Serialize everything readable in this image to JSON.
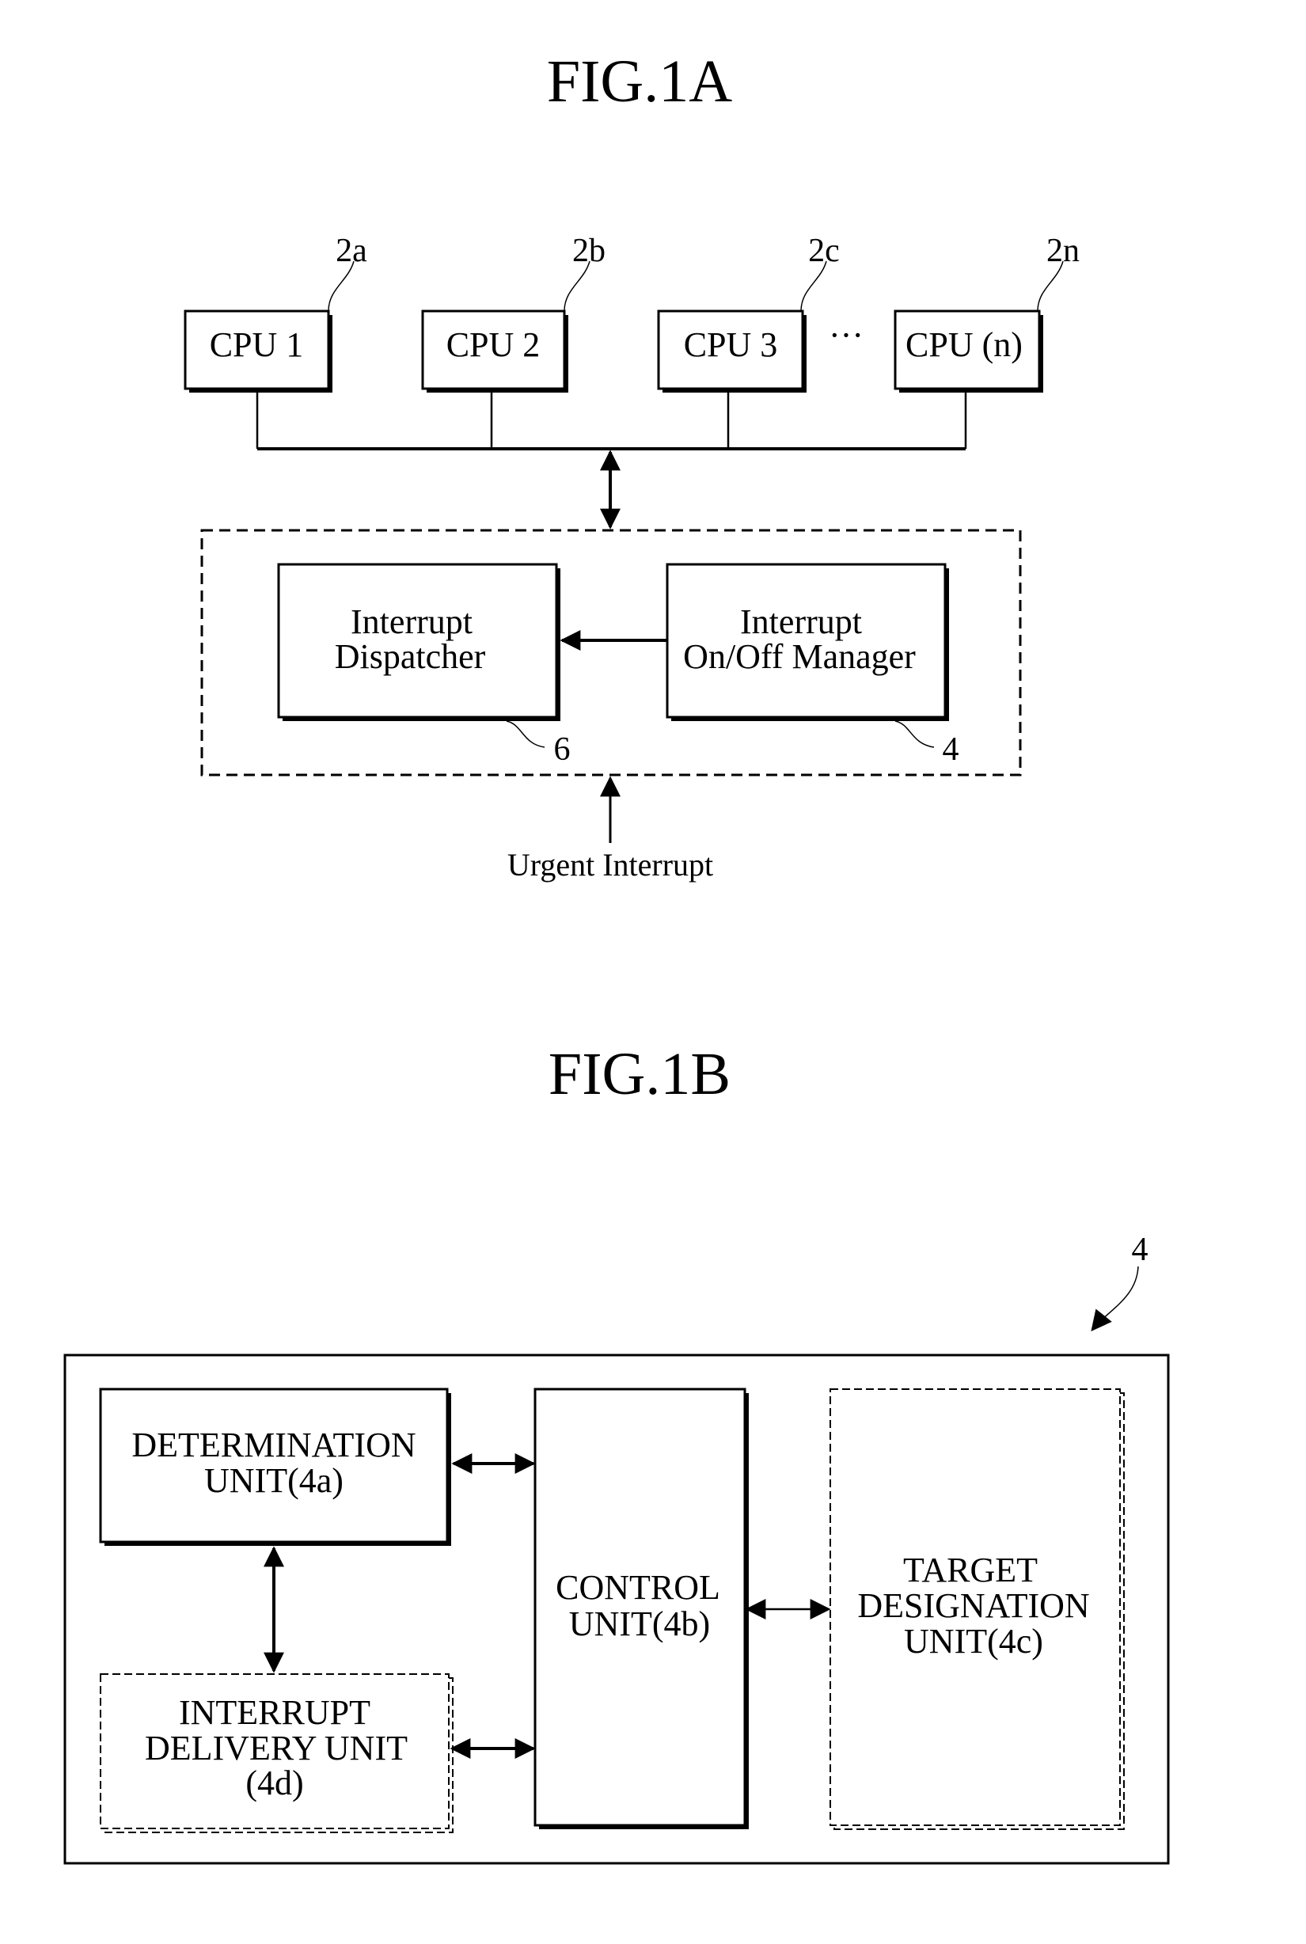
{
  "fig1a": {
    "title": "FIG.1A",
    "cpus": [
      {
        "label": "CPU 1",
        "ref": "2a"
      },
      {
        "label": "CPU 2",
        "ref": "2b"
      },
      {
        "label": "CPU 3",
        "ref": "2c"
      },
      {
        "label": "CPU (n)",
        "ref": "2n"
      }
    ],
    "ellipsis": "···",
    "dispatcher": {
      "line1": "Interrupt",
      "line2": "Dispatcher",
      "ref": "6"
    },
    "manager": {
      "line1": "Interrupt",
      "line2": "On/Off Manager",
      "ref": "4"
    },
    "urgent_label": "Urgent Interrupt"
  },
  "fig1b": {
    "title": "FIG.1B",
    "ref": "4",
    "determination": {
      "line1": "DETERMINATION",
      "line2": "UNIT(4a)"
    },
    "control": {
      "line1": "CONTROL",
      "line2": "UNIT(4b)"
    },
    "target": {
      "line1": "TARGET",
      "line2": "DESIGNATION",
      "line3": "UNIT(4c)"
    },
    "delivery": {
      "line1": "INTERRUPT",
      "line2": "DELIVERY UNIT",
      "line3": "(4d)"
    }
  }
}
